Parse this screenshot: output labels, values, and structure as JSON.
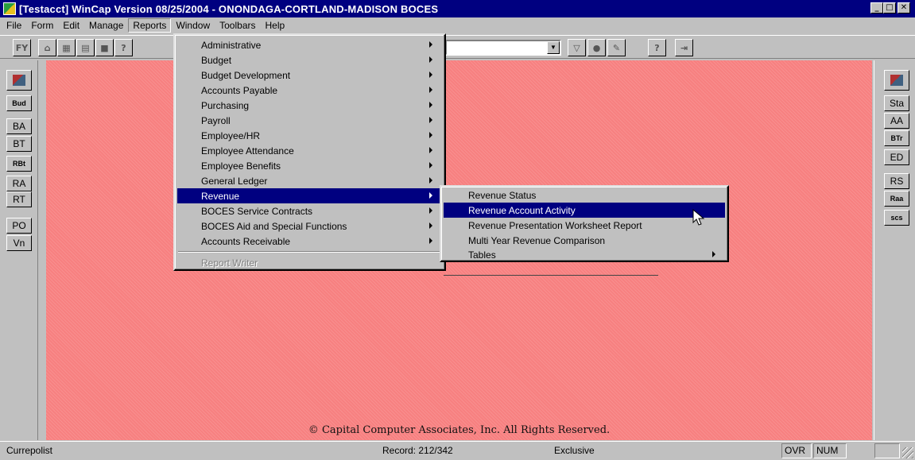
{
  "window": {
    "title": "[Testacct] WinCap Version 08/25/2004 - ONONDAGA-CORTLAND-MADISON BOCES",
    "controls": [
      "_",
      "□",
      "✕"
    ]
  },
  "menubar": [
    "File",
    "Form",
    "Edit",
    "Manage",
    "Reports",
    "Window",
    "Toolbars",
    "Help"
  ],
  "menubar_active": "Reports",
  "toolbar": {
    "left_buttons": [
      "FY",
      "⌂",
      "▦",
      "▤",
      "■",
      "?"
    ],
    "right_buttons": [
      "▽",
      "●",
      "✎",
      "?",
      "⇥"
    ]
  },
  "left_rail": [
    "",
    "Bud",
    "BA",
    "BT",
    "RBt",
    "RA",
    "RT",
    "PO",
    "Vn"
  ],
  "right_rail": [
    "",
    "Sta",
    "AA",
    "BTr",
    "ED",
    "RS",
    "Raa",
    "scs"
  ],
  "reports_menu": {
    "items": [
      {
        "label": "Administrative",
        "submenu": true
      },
      {
        "label": "Budget",
        "submenu": true
      },
      {
        "label": "Budget Development",
        "submenu": true
      },
      {
        "label": "Accounts Payable",
        "submenu": true
      },
      {
        "label": "Purchasing",
        "submenu": true
      },
      {
        "label": "Payroll",
        "submenu": true
      },
      {
        "label": "Employee/HR",
        "submenu": true
      },
      {
        "label": "Employee Attendance",
        "submenu": true
      },
      {
        "label": "Employee Benefits",
        "submenu": true
      },
      {
        "label": "General Ledger",
        "submenu": true
      },
      {
        "label": "Revenue",
        "submenu": true,
        "selected": true
      },
      {
        "label": "BOCES Service Contracts",
        "submenu": true
      },
      {
        "label": "BOCES Aid and Special Functions",
        "submenu": true
      },
      {
        "label": "Accounts Receivable",
        "submenu": true
      }
    ],
    "footer_item": {
      "label": "Report Writer",
      "disabled": true
    }
  },
  "revenue_submenu": {
    "items": [
      {
        "label": "Revenue Status",
        "submenu": false
      },
      {
        "label": "Revenue Account Activity",
        "submenu": false,
        "selected": true
      },
      {
        "label": "Revenue Presentation Worksheet Report",
        "submenu": false
      },
      {
        "label": "Multi Year Revenue Comparison",
        "submenu": false
      },
      {
        "label": "Tables",
        "submenu": true
      }
    ]
  },
  "workarea": {
    "background_color": "#f78080",
    "copyright": "© Capital Computer Associates, Inc.  All Rights Reserved."
  },
  "statusbar": {
    "form": "Currepolist",
    "record": "Record: 212/342",
    "mode": "Exclusive",
    "indicators": [
      "OVR",
      "NUM",
      ""
    ]
  },
  "colors": {
    "title_bar": "#000080",
    "selection": "#000080",
    "face": "#c0c0c0"
  }
}
